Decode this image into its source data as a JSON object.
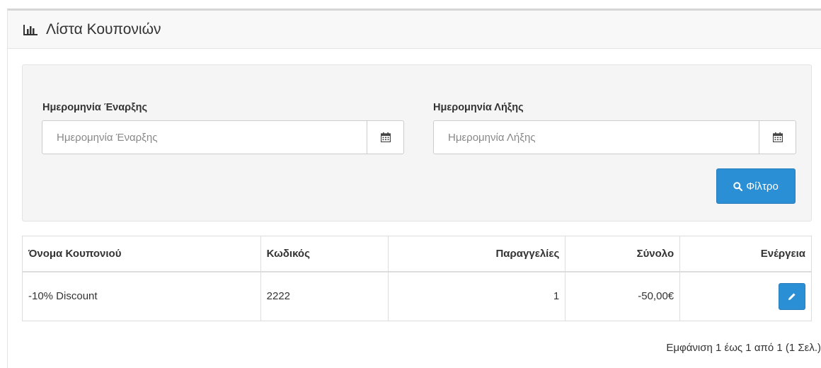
{
  "panel": {
    "title": "Λίστα Κουπονιών",
    "icon": "bar-chart-icon"
  },
  "filter": {
    "start_date": {
      "label": "Ημερομηνία Έναρξης",
      "placeholder": "Ημερομηνία Έναρξης",
      "value": "",
      "icon": "calendar-icon"
    },
    "end_date": {
      "label": "Ημερομηνία Λήξης",
      "placeholder": "Ημερομηνία Λήξης",
      "value": "",
      "icon": "calendar-icon"
    },
    "button_label": "Φίλτρο",
    "button_icon": "search-icon",
    "accent_color": "#2b8fd6"
  },
  "table": {
    "headers": [
      "Όνομα Κουπονιού",
      "Κωδικός",
      "Παραγγελίες",
      "Σύνολο",
      "Ενέργεια"
    ],
    "rows": [
      {
        "name": "-10% Discount",
        "code": "2222",
        "orders": "1",
        "total": "-50,00€",
        "action_icon": "pencil-icon"
      }
    ]
  },
  "pagination": {
    "text": "Εμφάνιση 1 έως 1 από 1 (1 Σελ.)"
  }
}
